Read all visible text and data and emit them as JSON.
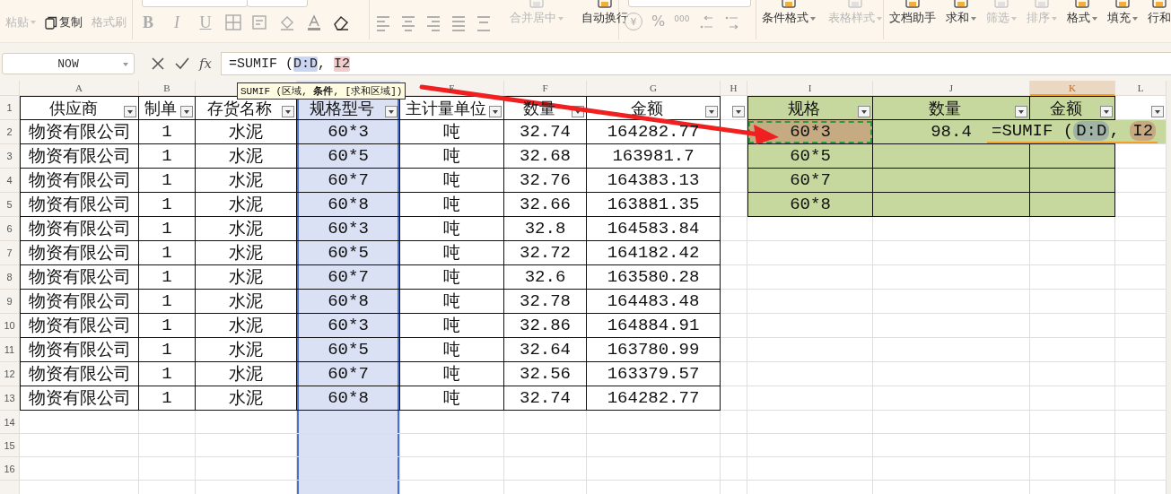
{
  "ribbon": {
    "groups": [
      {
        "kind": "clipboard",
        "items": [
          {
            "label": "粘贴",
            "disabled": true,
            "dropdown": true
          },
          {
            "label": "复制",
            "disabled": false,
            "dropdown": false
          },
          {
            "label": "格式刷",
            "disabled": true,
            "dropdown": false
          }
        ]
      },
      {
        "kind": "font",
        "toggles": [
          "B",
          "I",
          "U"
        ]
      },
      {
        "kind": "alignment",
        "items": [
          {
            "label": "合并居中",
            "disabled": true,
            "dropdown": true
          },
          {
            "label": "自动换行",
            "disabled": false,
            "dropdown": false
          }
        ]
      },
      {
        "kind": "number",
        "symbols": [
          "¥",
          "%",
          "000"
        ]
      },
      {
        "kind": "styles",
        "items": [
          {
            "label": "条件格式",
            "disabled": false,
            "dropdown": true
          },
          {
            "label": "表格样式",
            "disabled": true,
            "dropdown": true
          }
        ]
      },
      {
        "kind": "editing",
        "items": [
          {
            "label": "文档助手",
            "disabled": false,
            "dropdown": false
          },
          {
            "label": "求和",
            "disabled": false,
            "dropdown": true
          },
          {
            "label": "筛选",
            "disabled": true,
            "dropdown": true
          },
          {
            "label": "排序",
            "disabled": true,
            "dropdown": true
          },
          {
            "label": "格式",
            "disabled": false,
            "dropdown": true
          },
          {
            "label": "填充",
            "disabled": false,
            "dropdown": true
          },
          {
            "label": "行和",
            "disabled": false,
            "dropdown": false
          }
        ]
      }
    ]
  },
  "name_box": {
    "value": "NOW"
  },
  "formula_bar": {
    "fx": "fx",
    "segments": [
      {
        "text": "=SUMIF ("
      },
      {
        "text": "D:D",
        "color": "#c9d5f2"
      },
      {
        "text": ", "
      },
      {
        "text": "I2",
        "color": "#f2cccc"
      }
    ]
  },
  "function_tooltip": "SUMIF (区域, **条件**, [求和区域])",
  "sheet": {
    "columns": [
      {
        "label": "A",
        "selected": false,
        "active": false
      },
      {
        "label": "B",
        "selected": false,
        "active": false
      },
      {
        "selected": false,
        "active": false
      },
      {
        "selected": true,
        "active": false
      },
      {
        "label": "E",
        "selected": false,
        "active": false
      },
      {
        "label": "F",
        "selected": false,
        "active": false
      },
      {
        "label": "G",
        "selected": false,
        "active": false
      },
      {
        "label": "H",
        "selected": false,
        "active": false
      },
      {
        "label": "I",
        "selected": false,
        "active": false
      },
      {
        "label": "J",
        "selected": false,
        "active": false
      },
      {
        "label": "K",
        "selected": false,
        "active": true
      },
      {
        "label": "L",
        "selected": false,
        "active": false
      }
    ],
    "row_numbers": [
      "1",
      "2",
      "3",
      "4",
      "5",
      "6",
      "7",
      "8",
      "9",
      "10",
      "11",
      "12",
      "13",
      "14",
      "15",
      "16"
    ],
    "left_table": {
      "headers": [
        "供应商",
        "制单",
        "存货名称",
        "规格型号",
        "主计量单位",
        "数量",
        "金额"
      ],
      "rows": [
        [
          "物资有限公司",
          "1",
          "水泥",
          "60*3",
          "吨",
          "32.74",
          "164282.77"
        ],
        [
          "物资有限公司",
          "1",
          "水泥",
          "60*5",
          "吨",
          "32.68",
          "163981.7"
        ],
        [
          "物资有限公司",
          "1",
          "水泥",
          "60*7",
          "吨",
          "32.76",
          "164383.13"
        ],
        [
          "物资有限公司",
          "1",
          "水泥",
          "60*8",
          "吨",
          "32.66",
          "163881.35"
        ],
        [
          "物资有限公司",
          "1",
          "水泥",
          "60*3",
          "吨",
          "32.8",
          "164583.84"
        ],
        [
          "物资有限公司",
          "1",
          "水泥",
          "60*5",
          "吨",
          "32.72",
          "164182.42"
        ],
        [
          "物资有限公司",
          "1",
          "水泥",
          "60*7",
          "吨",
          "32.6",
          "163580.28"
        ],
        [
          "物资有限公司",
          "1",
          "水泥",
          "60*8",
          "吨",
          "32.78",
          "164483.48"
        ],
        [
          "物资有限公司",
          "1",
          "水泥",
          "60*3",
          "吨",
          "32.86",
          "164884.91"
        ],
        [
          "物资有限公司",
          "1",
          "水泥",
          "60*5",
          "吨",
          "32.64",
          "163780.99"
        ],
        [
          "物资有限公司",
          "1",
          "水泥",
          "60*7",
          "吨",
          "32.56",
          "163379.57"
        ],
        [
          "物资有限公司",
          "1",
          "水泥",
          "60*8",
          "吨",
          "32.74",
          "164282.77"
        ]
      ]
    },
    "right_table": {
      "headers": [
        "规格",
        "数量",
        "金额"
      ],
      "rows": [
        {
          "spec": "60*3",
          "quantity": "98.4",
          "marquee": true
        },
        {
          "spec": "60*5",
          "marquee": false
        },
        {
          "spec": "60*7",
          "marquee": false
        },
        {
          "spec": "60*8",
          "marquee": false
        }
      ]
    },
    "cell_editor": {
      "segments": [
        {
          "text": "=SUMIF ("
        },
        {
          "text": "D:D",
          "color": "#9fb4a6"
        },
        {
          "text": ", "
        },
        {
          "text": "I2",
          "color": "#c6a981"
        }
      ]
    }
  }
}
